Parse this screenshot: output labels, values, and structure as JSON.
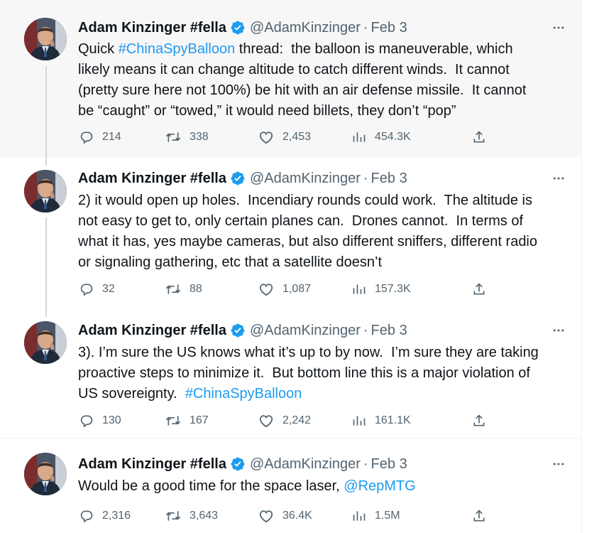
{
  "author": {
    "name": "Adam Kinzinger #fella",
    "handle": "@AdamKinzinger",
    "separator": "·"
  },
  "colors": {
    "link": "#1d9bf0",
    "verified": "#1d9bf0",
    "text": "#0f1419",
    "muted": "#536471",
    "highlight_bg": "#f7f7f7"
  },
  "tweets": [
    {
      "date": "Feb 3",
      "lines": [
        [
          {
            "text": "Quick ",
            "link": false
          },
          {
            "text": "#ChinaSpyBalloon",
            "link": true
          },
          {
            "text": " thread:  the balloon is maneuverable, which",
            "link": false
          }
        ],
        [
          {
            "text": "likely means it can change altitude to catch different winds.  It cannot",
            "link": false
          }
        ],
        [
          {
            "text": "(pretty sure here not 100%) be hit with an air defense missile.  It cannot",
            "link": false
          }
        ],
        [
          {
            "text": "be “caught” or “towed,” it would need billets, they don’t “pop”",
            "link": false
          }
        ]
      ],
      "replies": "214",
      "retweets": "338",
      "likes": "2,453",
      "views": "454.3K"
    },
    {
      "date": "Feb 3",
      "lines": [
        [
          {
            "text": "2) it would open up holes.  Incendiary rounds could work.  The altitude is",
            "link": false
          }
        ],
        [
          {
            "text": "not easy to get to, only certain planes can.  Drones cannot.  In terms of",
            "link": false
          }
        ],
        [
          {
            "text": "what it has, yes maybe cameras, but also different sniffers, different radio",
            "link": false
          }
        ],
        [
          {
            "text": "or signaling gathering, etc that a satellite doesn’t",
            "link": false
          }
        ]
      ],
      "replies": "32",
      "retweets": "88",
      "likes": "1,087",
      "views": "157.3K"
    },
    {
      "date": "Feb 3",
      "lines": [
        [
          {
            "text": "3). I’m sure the US knows what it’s up to by now.  I’m sure they are taking",
            "link": false
          }
        ],
        [
          {
            "text": "proactive steps to minimize it.  But bottom line this is a major violation of",
            "link": false
          }
        ],
        [
          {
            "text": "US sovereignty.  ",
            "link": false
          },
          {
            "text": "#ChinaSpyBalloon",
            "link": true
          }
        ]
      ],
      "replies": "130",
      "retweets": "167",
      "likes": "2,242",
      "views": "161.1K"
    },
    {
      "date": "Feb 3",
      "lines": [
        [
          {
            "text": "Would be a good time for the space laser, ",
            "link": false
          },
          {
            "text": "@RepMTG",
            "link": true
          }
        ]
      ],
      "replies": "2,316",
      "retweets": "3,643",
      "likes": "36.4K",
      "views": "1.5M"
    }
  ],
  "icons": {
    "more": "more-horizontal-icon",
    "verified": "verified-badge-icon",
    "reply": "reply-icon",
    "retweet": "retweet-icon",
    "like": "heart-icon",
    "views": "views-icon",
    "share": "share-icon"
  }
}
